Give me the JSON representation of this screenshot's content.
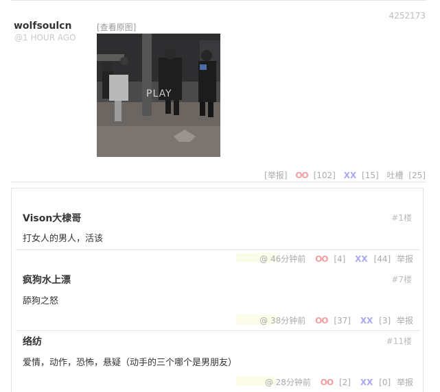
{
  "post": {
    "id": "4252173",
    "author": "wolfsoulcn",
    "time": "@1 HOUR AGO",
    "view_original": "[查看原图]",
    "play_label": "PLAY",
    "actions": {
      "report": "[举报]",
      "oo_symbol": "OO",
      "oo_count": "[102]",
      "xx_symbol": "XX",
      "xx_count": "[15]",
      "tucao_label": "吐槽",
      "tucao_count": "[25]"
    }
  },
  "comments": [
    {
      "author": "Vison大棣哥",
      "floor": "#1楼",
      "text": "打女人的男人，活该",
      "time": "@  46分钟前",
      "oo_symbol": "OO",
      "oo_count": "[4]",
      "xx_symbol": "XX",
      "xx_count": "[44]",
      "report": "举报"
    },
    {
      "author": "疯狗水上漂",
      "floor": "#7楼",
      "text": "舔狗之怒",
      "time": "@  38分钟前",
      "oo_symbol": "OO",
      "oo_count": "[37]",
      "xx_symbol": "XX",
      "xx_count": "[3]",
      "report": "举报"
    },
    {
      "author": "络纺",
      "floor": "#11楼",
      "text": "爱情，动作，恐怖，悬疑（动手的三个哪个是男朋友）",
      "time": "@  28分钟前",
      "oo_symbol": "OO",
      "oo_count": "[2]",
      "xx_symbol": "XX",
      "xx_count": "[0]",
      "report": "举报"
    }
  ],
  "colors": {
    "oo": "#f39ea0",
    "xx": "#a8a8f2",
    "muted": "#aaaaaa"
  }
}
